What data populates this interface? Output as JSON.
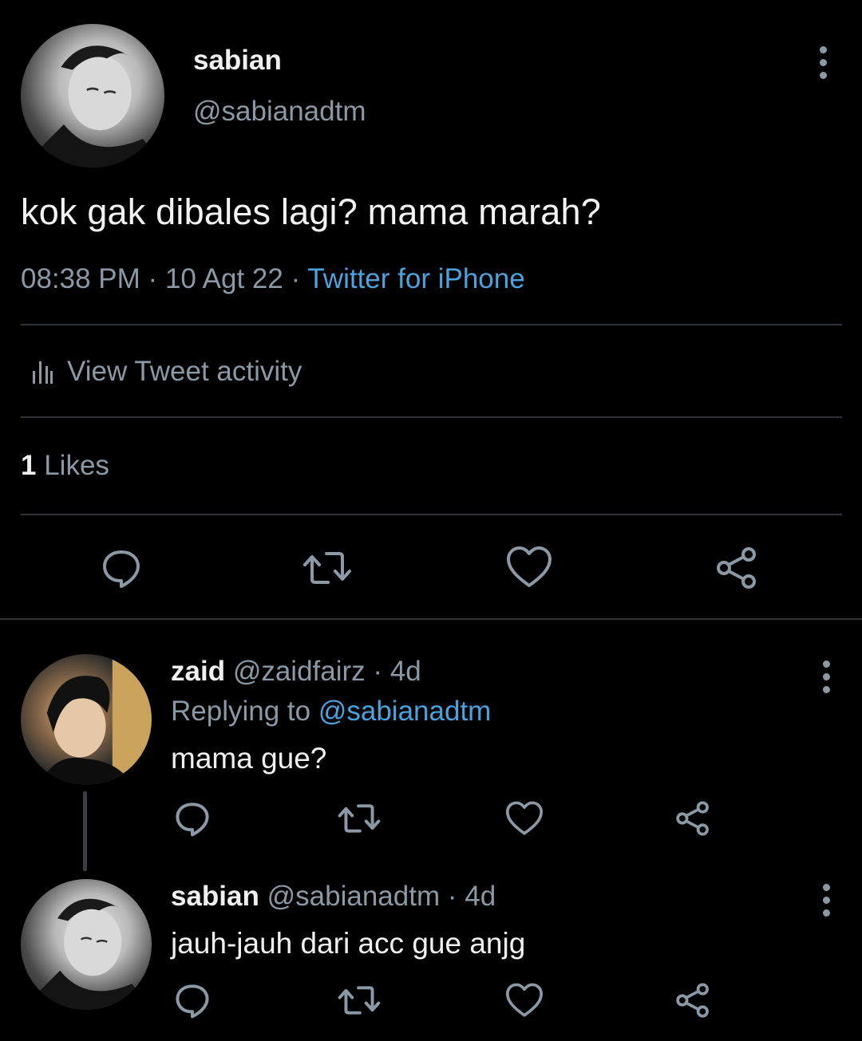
{
  "main_tweet": {
    "name": "sabian",
    "handle": "@sabianadtm",
    "text": "kok gak dibales lagi? mama marah?",
    "time": "08:38 PM",
    "date": "10 Agt 22",
    "source": "Twitter for iPhone",
    "activity_label": "View Tweet activity",
    "likes_count": "1",
    "likes_label": "Likes",
    "icons": {
      "more": "kebab-icon",
      "activity": "bar-chart-icon",
      "reply": "reply-icon",
      "retweet": "retweet-icon",
      "like": "heart-icon",
      "share": "share-icon"
    }
  },
  "replies": [
    {
      "name": "zaid",
      "handle": "@zaidfairz",
      "time": "4d",
      "replying_prefix": "Replying to",
      "replying_to": "@sabianadtm",
      "text": "mama gue?"
    },
    {
      "name": "sabian",
      "handle": "@sabianadtm",
      "time": "4d",
      "text": "jauh-jauh dari acc gue anjg"
    }
  ],
  "colors": {
    "background": "#000000",
    "primary_text": "#f0f0f0",
    "secondary_text": "#8b98a5",
    "link": "#4aa3df",
    "divider": "#2f3336"
  }
}
